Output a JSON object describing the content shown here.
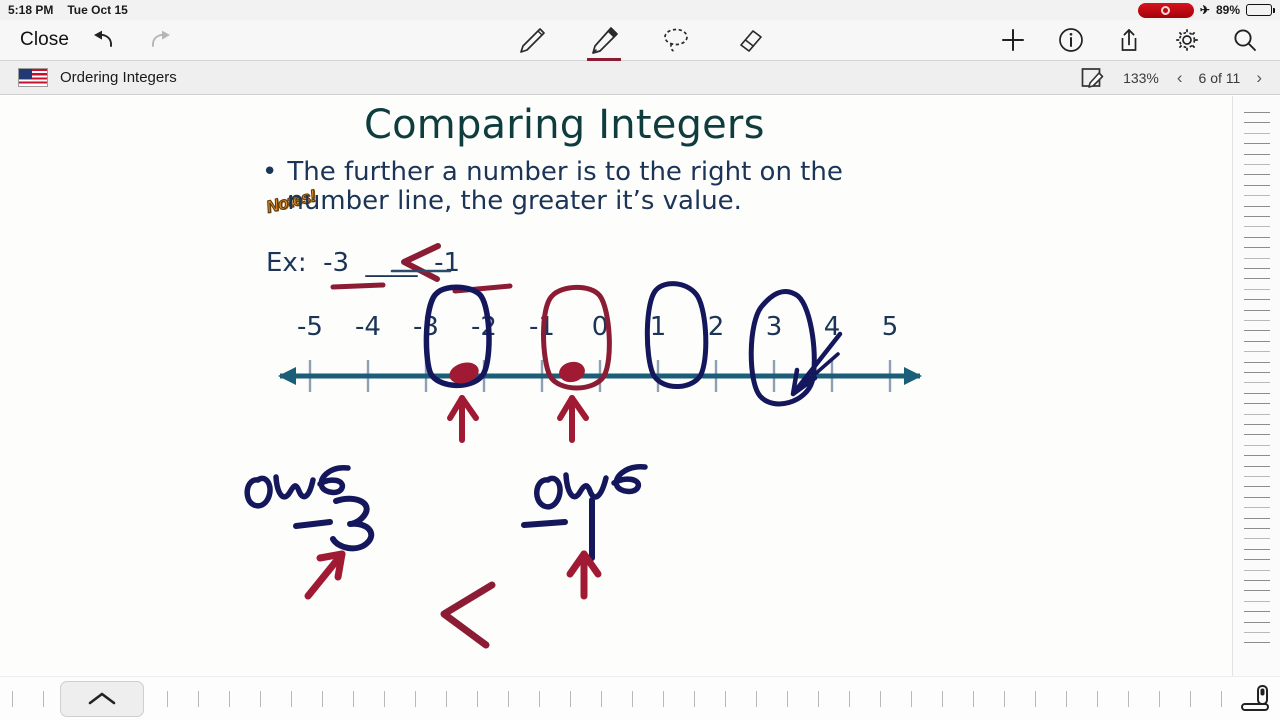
{
  "statusbar": {
    "time": "5:18 PM",
    "date": "Tue Oct 15",
    "recording_icon": "record-circle-icon",
    "airplane_icon": "airplane-mode-icon",
    "airplane_glyph": "✈",
    "battery_percent": "89%",
    "battery_level": 89,
    "recording_color": "#c5000b"
  },
  "toolbar": {
    "close_label": "Close",
    "undo_icon": "undo-arrow-icon",
    "redo_icon": "redo-arrow-icon",
    "tools": [
      {
        "name": "pen-tool",
        "label": "Pen",
        "selected": false
      },
      {
        "name": "pencil-tool",
        "label": "Pencil",
        "selected": true
      },
      {
        "name": "lasso-tool",
        "label": "Lasso",
        "selected": false
      },
      {
        "name": "eraser-tool",
        "label": "Eraser",
        "selected": false
      }
    ],
    "selected_tool_underline_color": "#8c1c33",
    "actions": [
      {
        "name": "add-button",
        "label": "Add"
      },
      {
        "name": "info-button",
        "label": "Info"
      },
      {
        "name": "share-button",
        "label": "Share"
      },
      {
        "name": "settings-button",
        "label": "Settings"
      },
      {
        "name": "search-button",
        "label": "Search"
      }
    ]
  },
  "titlebar": {
    "flag_icon": "us-flag-icon",
    "document_title": "Ordering Integers",
    "annotate_icon": "edit-page-icon",
    "zoom_level": "133%",
    "prev_glyph": "‹",
    "next_glyph": "›",
    "page_indicator": "6 of 11",
    "page_current": 6,
    "page_total": 11
  },
  "slide": {
    "notes_badge": "Notes!",
    "notes_badge_color": "#e0912f",
    "title": "Comparing Integers",
    "title_color": "#0f3d3e",
    "bullet_dot": "•",
    "bullet_text": "The further a number is to the right on the number line, the greater it’s value.",
    "bullet_lines": [
      "The further a number is to the right",
      "on the number line, the greater it’s",
      "value."
    ],
    "example_line": "Ex:  -3  ____  -1",
    "example_prefix": "Ex:",
    "example_left": "-3",
    "example_blank": "____",
    "example_right": "-1",
    "body_color": "#1c3557"
  },
  "chart_data": {
    "type": "numberline",
    "title": "Comparing Integers number line",
    "ticks": [
      -5,
      -4,
      -3,
      -2,
      -1,
      0,
      1,
      2,
      3,
      4,
      5
    ],
    "tick_labels": [
      "-5",
      "-4",
      "-3",
      "-2",
      "-1",
      "0",
      "1",
      "2",
      "3",
      "4",
      "5"
    ],
    "xlim": [
      -5.6,
      5.6
    ],
    "line_color": "#1b5e77",
    "tick_color": "#8fa0b3",
    "label_color": "#1c3557",
    "arrows_both_ends": true,
    "annotations": [
      {
        "kind": "oval",
        "at": -3,
        "color": "#14175c",
        "label": "circle around -3"
      },
      {
        "kind": "oval",
        "at": -1,
        "color": "#8c1c33",
        "label": "circle around -1"
      },
      {
        "kind": "oval",
        "at": 1,
        "color": "#14175c",
        "label": "circle around 1"
      },
      {
        "kind": "oval",
        "at": 3,
        "color": "#14175c",
        "label": "circle around 3"
      },
      {
        "kind": "dot",
        "at": -3,
        "color": "#a01a33",
        "label": "point at -3"
      },
      {
        "kind": "dot",
        "at": -1,
        "color": "#a01a33",
        "label": "point at -1"
      },
      {
        "kind": "arrow-up",
        "at": -3,
        "color": "#a01a33",
        "label": "arrow pointing to -3"
      },
      {
        "kind": "arrow-up",
        "at": -1,
        "color": "#a01a33",
        "label": "arrow pointing to -1"
      },
      {
        "kind": "arrow-down-left",
        "at": 3,
        "color": "#14175c",
        "label": "arrow pointing to 3"
      }
    ]
  },
  "handwriting": {
    "ink_navy": "#14175c",
    "ink_red": "#8c1c33",
    "less_than_in_blank": "<",
    "underline_left": "-3",
    "underline_right": "-1",
    "work_left_word": "owe",
    "work_left_value": "-3",
    "work_operator": "<",
    "work_right_word": "owe",
    "work_right_value": "-1",
    "work_expression": "owe -3 < owe -1"
  },
  "right_ruler": {
    "name": "page-scroll-ruler",
    "tick_count": 52,
    "stylus_icon": "stylus-icon"
  },
  "bottombar": {
    "collapse_icon": "chevron-up-icon",
    "collapse_glyph": "⌃",
    "tick_count": 40
  }
}
